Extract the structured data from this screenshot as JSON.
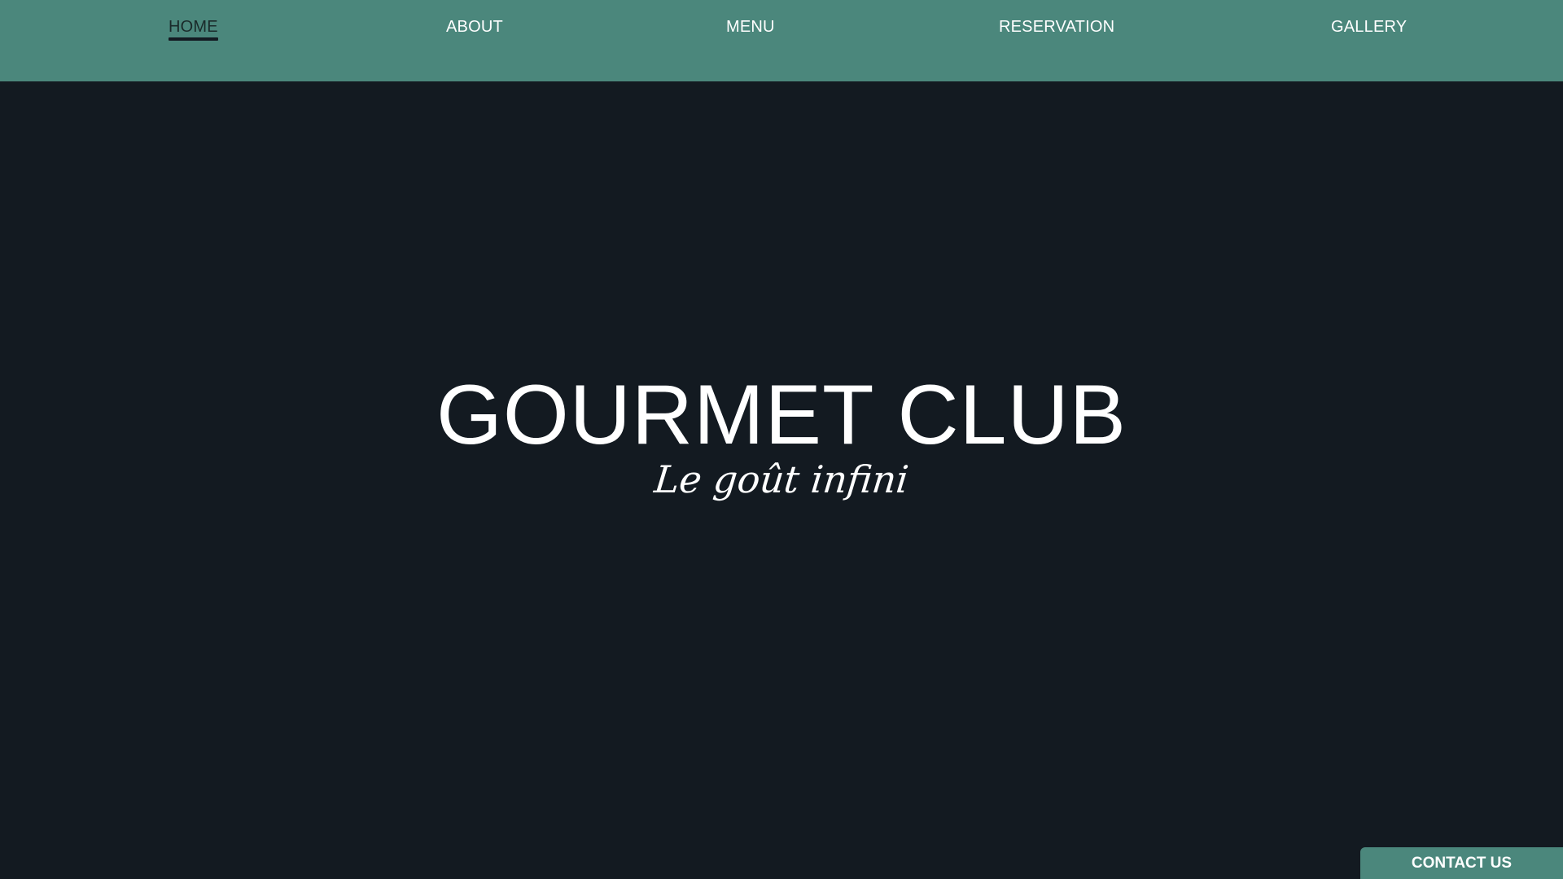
{
  "nav": {
    "items": [
      {
        "label": "HOME",
        "active": true
      },
      {
        "label": "ABOUT",
        "active": false
      },
      {
        "label": "MENU",
        "active": false
      },
      {
        "label": "RESERVATION",
        "active": false
      },
      {
        "label": "GALLERY",
        "active": false
      }
    ]
  },
  "hero": {
    "title": "GOURMET CLUB",
    "tagline": "Le goût infini"
  },
  "contact": {
    "label": "CONTACT US"
  },
  "colors": {
    "nav_background": "#4b877c",
    "page_background": "#131a21",
    "text": "#ffffff"
  }
}
